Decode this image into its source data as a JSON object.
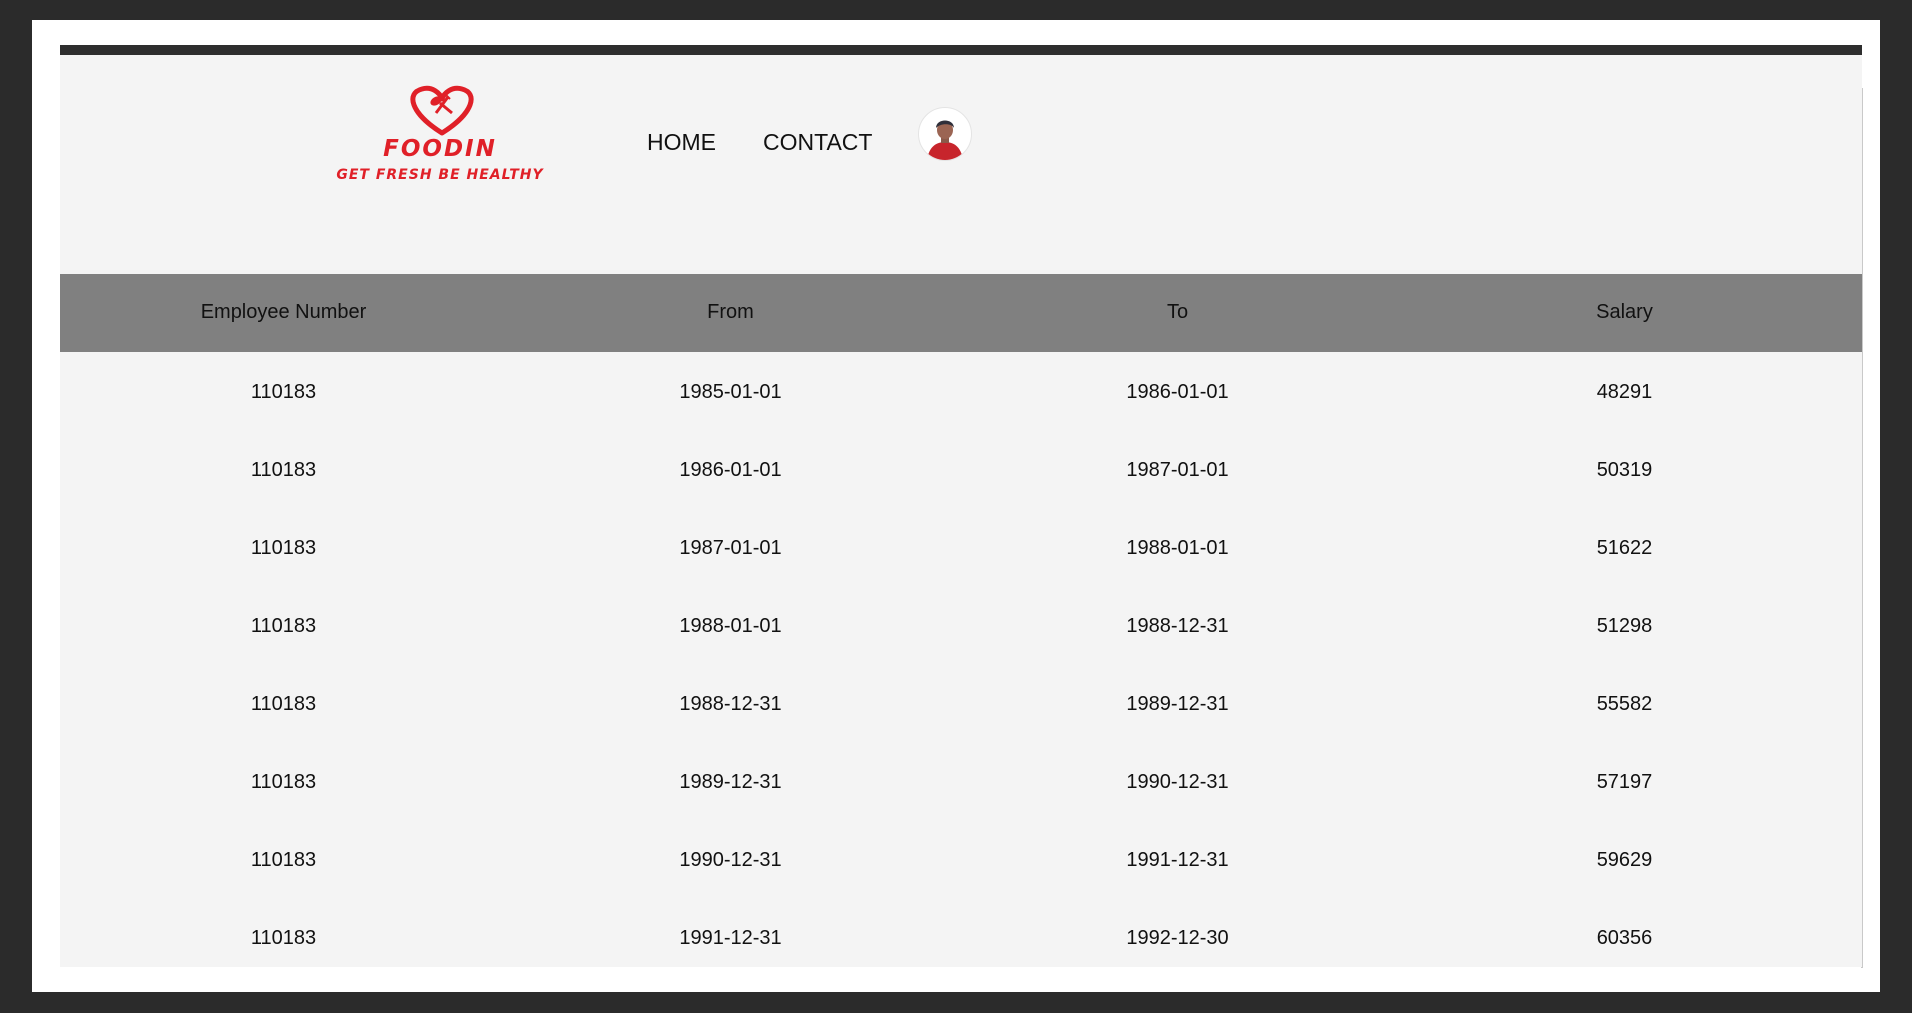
{
  "brand": {
    "name": "FOODIN",
    "tagline": "GET FRESH BE HEALTHY",
    "color": "#e02028",
    "icon": "heart-spoon-fork-icon"
  },
  "nav": {
    "home": "HOME",
    "contact": "CONTACT",
    "avatar_icon": "user-avatar-icon"
  },
  "table": {
    "header_color": "#808080",
    "columns": [
      "Employee Number",
      "From",
      "To",
      "Salary"
    ],
    "rows": [
      [
        "110183",
        "1985-01-01",
        "1986-01-01",
        "48291"
      ],
      [
        "110183",
        "1986-01-01",
        "1987-01-01",
        "50319"
      ],
      [
        "110183",
        "1987-01-01",
        "1988-01-01",
        "51622"
      ],
      [
        "110183",
        "1988-01-01",
        "1988-12-31",
        "51298"
      ],
      [
        "110183",
        "1988-12-31",
        "1989-12-31",
        "55582"
      ],
      [
        "110183",
        "1989-12-31",
        "1990-12-31",
        "57197"
      ],
      [
        "110183",
        "1990-12-31",
        "1991-12-31",
        "59629"
      ],
      [
        "110183",
        "1991-12-31",
        "1992-12-30",
        "60356"
      ]
    ]
  }
}
